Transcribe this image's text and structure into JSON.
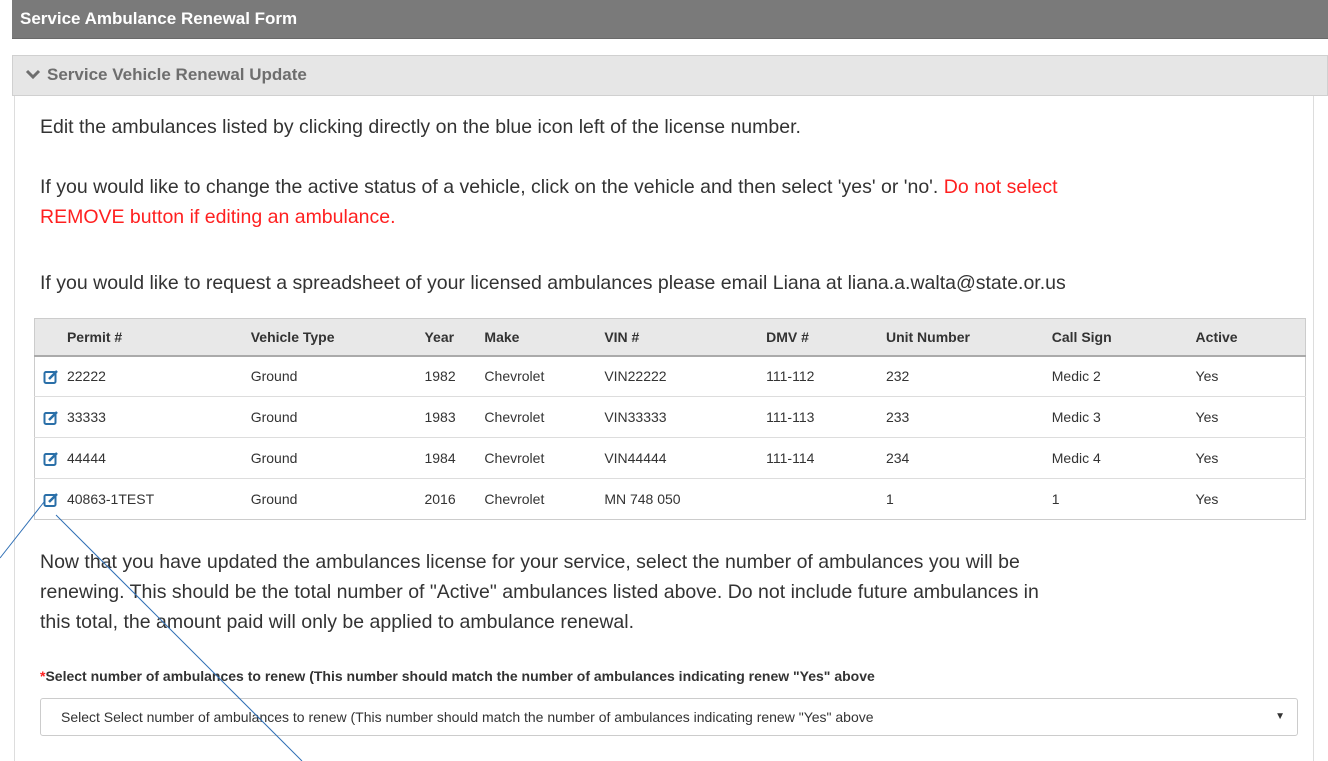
{
  "header": {
    "title": "Service Ambulance Renewal Form"
  },
  "section": {
    "title": "Service Vehicle Renewal Update"
  },
  "instructions": {
    "p1": "Edit the ambulances listed by clicking directly on the blue icon left of the license number.",
    "p2_a": "If you would like to change the active status of a vehicle, click on the vehicle and then select 'yes' or 'no'.",
    "p2_b": "Do not select",
    "p2_c": "REMOVE button if editing an ambulance.",
    "p3": "If you would like to request a spreadsheet of your licensed ambulances please email Liana at liana.a.walta@state.or.us"
  },
  "table": {
    "columns": [
      "Permit #",
      "Vehicle Type",
      "Year",
      "Make",
      "VIN #",
      "DMV #",
      "Unit Number",
      "Call Sign",
      "Active"
    ],
    "rows": [
      [
        "22222",
        "Ground",
        "1982",
        "Chevrolet",
        "VIN22222",
        "111-112",
        "232",
        "Medic 2",
        "Yes"
      ],
      [
        "33333",
        "Ground",
        "1983",
        "Chevrolet",
        "VIN33333",
        "111-113",
        "233",
        "Medic 3",
        "Yes"
      ],
      [
        "44444",
        "Ground",
        "1984",
        "Chevrolet",
        "VIN44444",
        "111-114",
        "234",
        "Medic 4",
        "Yes"
      ],
      [
        "40863-1TEST",
        "Ground",
        "2016",
        "Chevrolet",
        "MN 748 050",
        "",
        "1",
        "1",
        "Yes"
      ]
    ]
  },
  "summary": {
    "line1": "Now that you have updated the ambulances license for your service, select the number of ambulances you will be",
    "line2": "renewing. This should be the total number of \"Active\" ambulances listed above. Do not include future ambulances in",
    "line3": "this total, the amount paid will only be applied to ambulance renewal."
  },
  "field": {
    "required_mark": "*",
    "label": "Select number of ambulances to renew (This number should match the number of ambulances indicating renew \"Yes\" above",
    "selected": "Select Select number of ambulances to renew (This number should match the number of ambulances indicating renew \"Yes\" above"
  },
  "colors": {
    "header_bg": "#7a7a7a",
    "edit_icon": "#2a6fa8",
    "warning": "#ff2020",
    "annotation_line": "#2f6fb5"
  }
}
